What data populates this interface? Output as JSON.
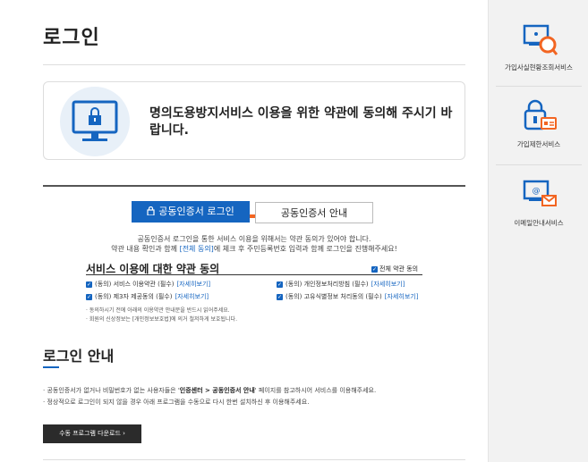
{
  "page": {
    "title": "로그인"
  },
  "notice": {
    "text": "명의도용방지서비스 이용을 위한 약관에 동의해 주시기 바랍니다."
  },
  "tabs": [
    {
      "label": "공동인증서 로그인",
      "active": true
    },
    {
      "label": "공동인증서 안내",
      "active": false
    }
  ],
  "description": {
    "line1": "공동인증서 로그인을 통한 서비스 이용을 위해서는 약관 동의가 있어야 합니다.",
    "line2_pre": "약관 내용 확인과 함께 ",
    "line2_link": "[전체 동의]",
    "line2_post": "에 체크 후 주민등록번호 입력과 함께 로그인을 진행해주세요!"
  },
  "terms": {
    "title": "서비스 이용에 대한 약관 동의",
    "all_agree": "전체 약관 동의",
    "items": [
      {
        "label": "(동의) 서비스 이용약관 (필수)",
        "more": "[자세히보기]"
      },
      {
        "label": "(동의) 개인정보처리방침 (필수)",
        "more": "[자세히보기]"
      },
      {
        "label": "(동의) 제3자 제공동의 (필수)",
        "more": "[자세히보기]"
      },
      {
        "label": "(동의) 고유식별정보 처리동의 (필수)",
        "more": "[자세히보기]"
      }
    ],
    "notes": [
      "· 동의하시기 전에 아래의 이용약관 안내문을 반드시 읽어주세요.",
      "· 회원의 신상정보는 [개인정보보호법]에 의거 철저하게 보호됩니다."
    ]
  },
  "guide": {
    "title": "로그인 안내",
    "line1_pre": "· 공동인증서가 없거나 비밀번호가 없는 사용자들은 '",
    "line1_bold": "인증센터 > 공동인증서 안내",
    "line1_post": "' 페이지를 참고하시어 서비스를 이용해주세요.",
    "line2": "· 정상적으로 로그인이 되지 않을 경우 아래 프로그램을 수동으로 다시 한번 설치하신 후 이용해주세요.",
    "download_label": "수동 프로그램 다운로드  ›"
  },
  "sidebar": {
    "items": [
      {
        "label": "가입사실현황조회서비스",
        "icon": "monitor-search-icon"
      },
      {
        "label": "가입제한서비스",
        "icon": "lock-id-icon"
      },
      {
        "label": "이메일안내서비스",
        "icon": "monitor-mail-icon"
      }
    ]
  },
  "colors": {
    "primary": "#1565c0",
    "accent": "#f26522",
    "dark_button": "#2b2b2b"
  }
}
